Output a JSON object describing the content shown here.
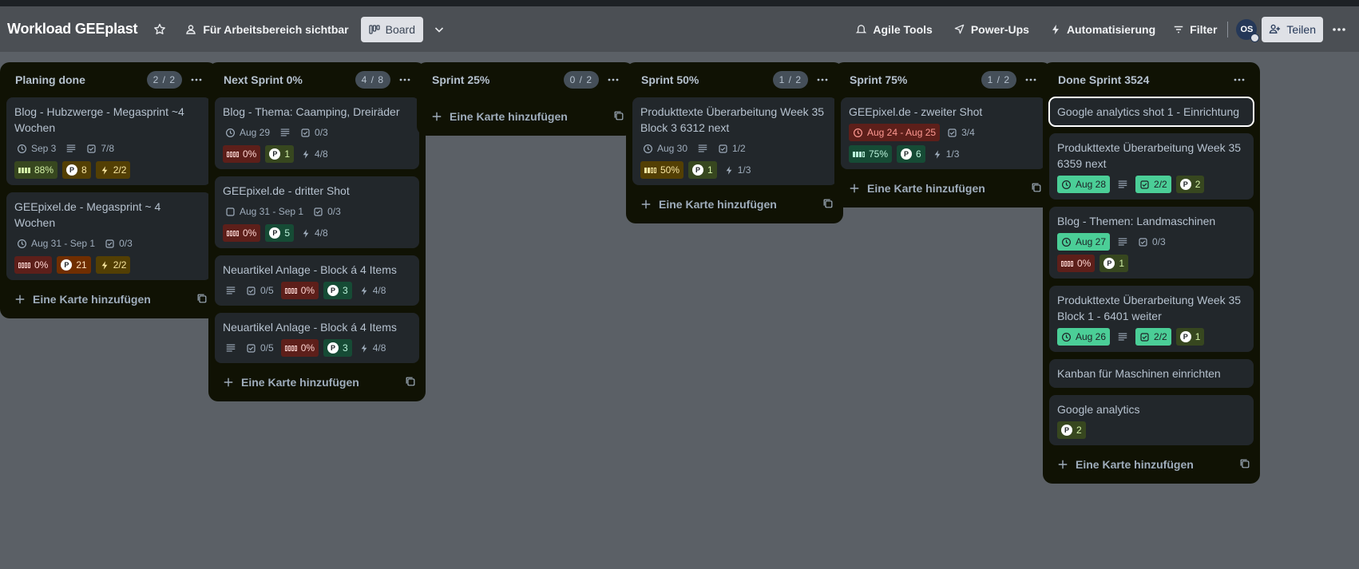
{
  "board": {
    "title": "Workload GEEplast",
    "visibility_label": "Für Arbeitsbereich sichtbar",
    "view_label": "Board",
    "agile_tools_label": "Agile Tools",
    "powerups_label": "Power-Ups",
    "automation_label": "Automatisierung",
    "filter_label": "Filter",
    "avatar_initials": "OS",
    "share_label": "Teilen"
  },
  "add_card_label": "Eine Karte hinzufügen",
  "lists": [
    {
      "title": "Planing done",
      "count": "2 / 2",
      "cards": [
        {
          "title": "Blog - Hubzwerge - Megasprint ~4 Wochen",
          "date": "Sep 3",
          "checklist": "7/8",
          "progress": "88%",
          "points": "8",
          "power": "2/2"
        },
        {
          "title": "GEEpixel.de - Megasprint ~ 4 Wochen",
          "date": "Aug 31 - Sep 1",
          "checklist": "0/3",
          "progress": "0%",
          "points": "21",
          "power": "2/2"
        }
      ]
    },
    {
      "title": "Next Sprint 0%",
      "count": "4 / 8",
      "cards": [
        {
          "title": "Blog - Thema: Caamping, Dreiräder",
          "date": "Aug 29",
          "checklist": "0/3",
          "progress": "0%",
          "points": "1",
          "power": "4/8"
        },
        {
          "title": "GEEpixel.de - dritter Shot",
          "date": "Aug 31 - Sep 1",
          "checklist": "0/3",
          "progress": "0%",
          "points": "5",
          "power": "4/8"
        },
        {
          "title": "Neuartikel Anlage - Block á 4 Items",
          "checklist": "0/5",
          "progress": "0%",
          "points": "3",
          "power": "4/8"
        },
        {
          "title": "Neuartikel Anlage - Block á 4 Items",
          "checklist": "0/5",
          "progress": "0%",
          "points": "3",
          "power": "4/8"
        }
      ]
    },
    {
      "title": "Sprint 25%",
      "count": "0 / 2",
      "cards": []
    },
    {
      "title": "Sprint 50%",
      "count": "1 / 2",
      "cards": [
        {
          "title": "Produkttexte Überarbeitung Week 35 Block 3 6312 next",
          "date": "Aug 30",
          "checklist": "1/2",
          "progress": "50%",
          "points": "1",
          "power": "1/3"
        }
      ]
    },
    {
      "title": "Sprint 75%",
      "count": "1 / 2",
      "cards": [
        {
          "title": "GEEpixel.de - zweiter Shot",
          "date": "Aug 24 - Aug 25",
          "checklist": "3/4",
          "progress": "75%",
          "points": "6",
          "power": "1/3"
        }
      ]
    },
    {
      "title": "Done Sprint 3524",
      "cards": [
        {
          "title": "Google analytics shot 1 - Einrichtung"
        },
        {
          "title": "Produkttexte Überarbeitung Week 35 6359 next",
          "date": "Aug 28",
          "checklist": "2/2",
          "points": "2"
        },
        {
          "title": "Blog - Themen: Landmaschinen",
          "date": "Aug 27",
          "checklist": "0/3",
          "progress": "0%",
          "points": "1"
        },
        {
          "title": "Produkttexte Überarbeitung Week 35 Block 1 - 6401 weiter",
          "date": "Aug 26",
          "checklist": "2/2",
          "points": "1"
        },
        {
          "title": "Kanban für Maschinen einrichten"
        },
        {
          "title": "Google analytics",
          "points": "2"
        }
      ]
    }
  ]
}
